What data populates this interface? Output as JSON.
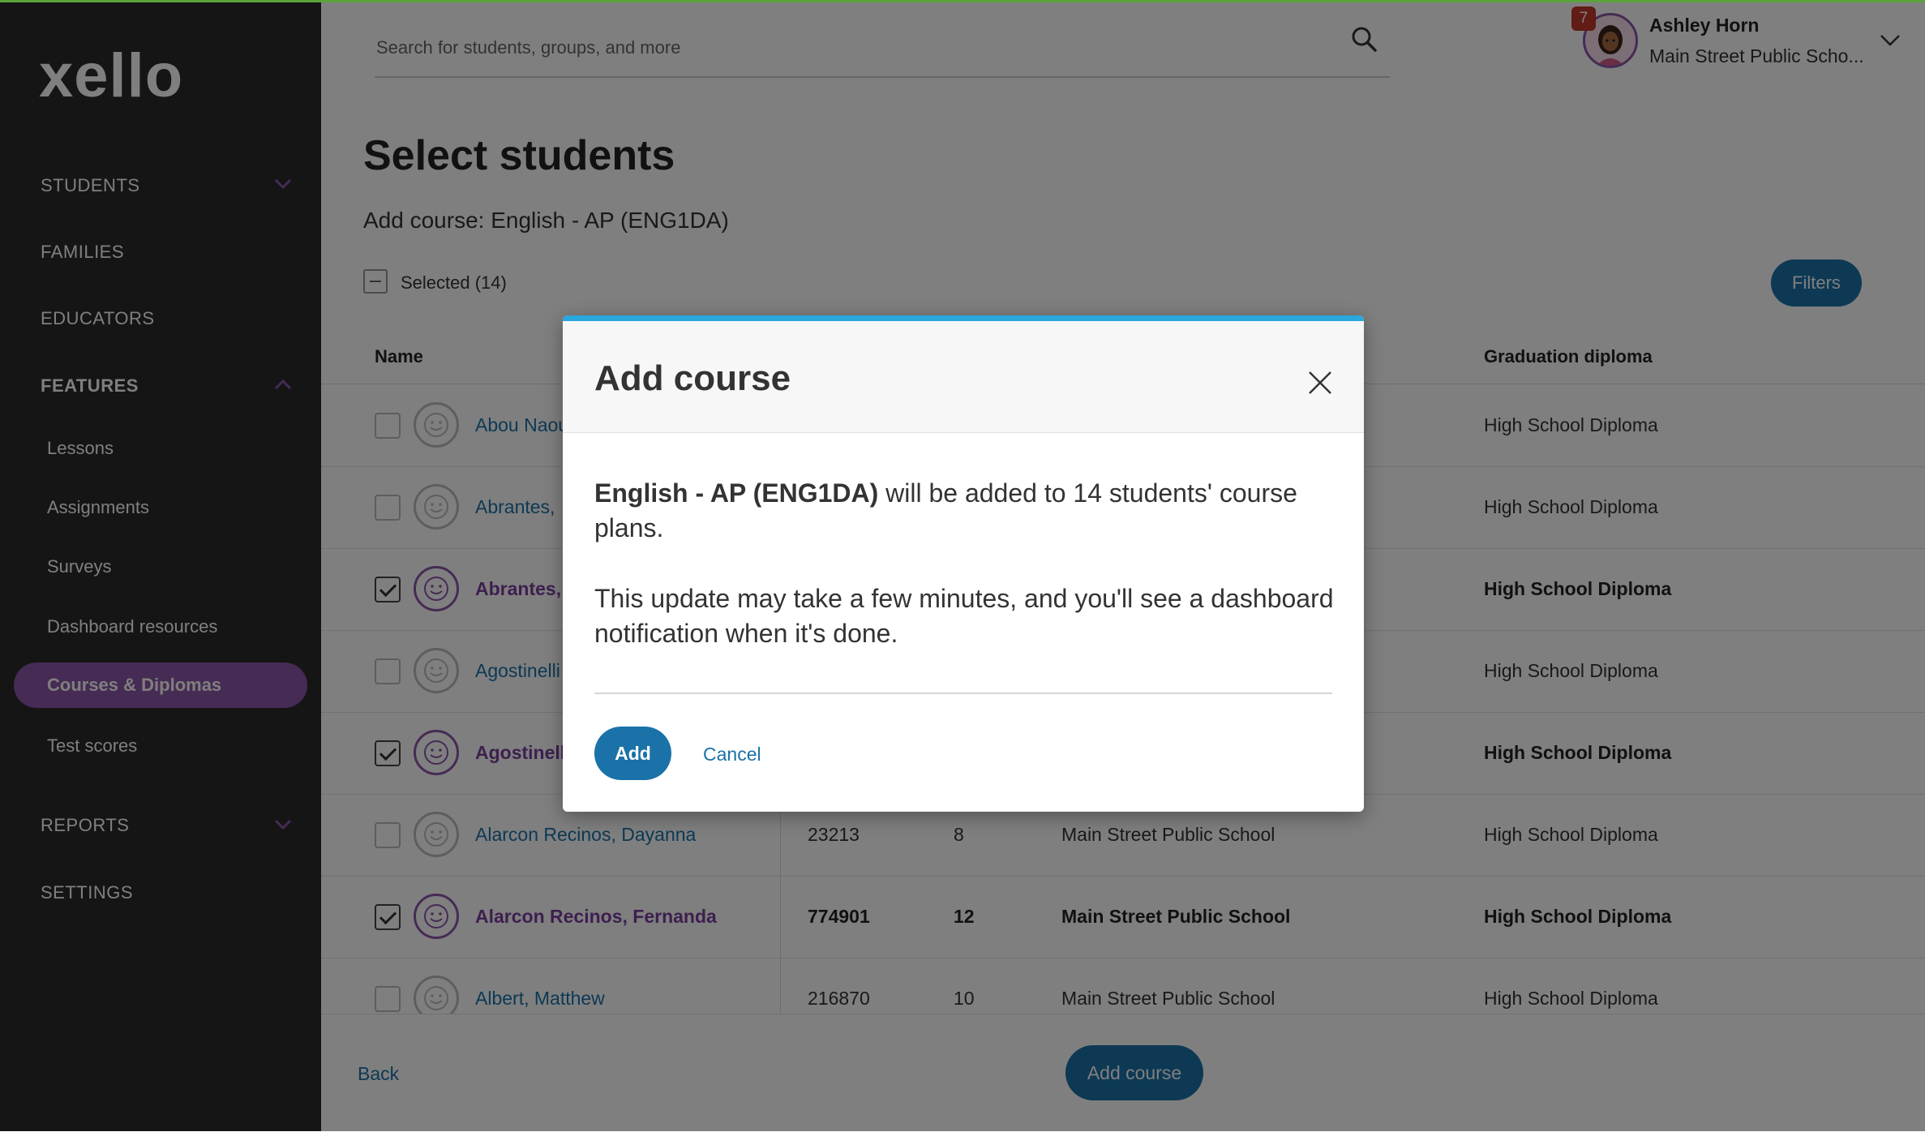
{
  "brand": {
    "logo_text": "xello",
    "accent": "#8c57a8",
    "primary": "#1a72a8",
    "sidebar_bg": "#2b2b2b"
  },
  "sidebar": {
    "students": "STUDENTS",
    "families": "FAMILIES",
    "educators": "EDUCATORS",
    "features": "FEATURES",
    "lessons": "Lessons",
    "assignments": "Assignments",
    "surveys": "Surveys",
    "dashboard_resources": "Dashboard resources",
    "courses_diplomas": "Courses & Diplomas",
    "test_scores": "Test scores",
    "reports": "REPORTS",
    "settings": "SETTINGS"
  },
  "search": {
    "placeholder": "Search for students, groups, and more"
  },
  "user": {
    "name": "Ashley Horn",
    "school": "Main Street Public Scho...",
    "notification_count": "7"
  },
  "page": {
    "title": "Select students",
    "subtitle": "Add course: English - AP (ENG1DA)",
    "selected_label": "Selected (14)",
    "filters_label": "Filters"
  },
  "table": {
    "headers": {
      "name": "Name",
      "diploma": "Graduation diploma"
    },
    "rows": [
      {
        "name": "Abou Naou",
        "id": "",
        "grade": "",
        "school": "",
        "diploma": "High School Diploma",
        "selected": false
      },
      {
        "name": "Abrantes,",
        "id": "",
        "grade": "",
        "school": "",
        "diploma": "High School Diploma",
        "selected": false
      },
      {
        "name": "Abrantes,",
        "id": "",
        "grade": "",
        "school": "",
        "diploma": "High School Diploma",
        "selected": true
      },
      {
        "name": "Agostinelli",
        "id": "",
        "grade": "",
        "school": "",
        "diploma": "High School Diploma",
        "selected": false
      },
      {
        "name": "Agostinell",
        "id": "",
        "grade": "",
        "school": "",
        "diploma": "High School Diploma",
        "selected": true
      },
      {
        "name": "Alarcon Recinos, Dayanna",
        "id": "23213",
        "grade": "8",
        "school": "Main Street Public School",
        "diploma": "High School Diploma",
        "selected": false
      },
      {
        "name": "Alarcon Recinos, Fernanda",
        "id": "774901",
        "grade": "12",
        "school": "Main Street Public School",
        "diploma": "High School Diploma",
        "selected": true
      },
      {
        "name": "Albert, Matthew",
        "id": "216870",
        "grade": "10",
        "school": "Main Street Public School",
        "diploma": "High School Diploma",
        "selected": false
      }
    ]
  },
  "footer": {
    "back_label": "Back",
    "add_course_label": "Add course"
  },
  "modal": {
    "title": "Add course",
    "course_name": "English - AP (ENG1DA)",
    "message_rest": " will be added to 14 students' course plans.",
    "message2": "This update may take a few minutes, and you'll see a dashboard notification when it's done.",
    "add_label": "Add",
    "cancel_label": "Cancel"
  },
  "icons": {
    "search": "search-icon",
    "close": "close-icon",
    "chevron": "chevron-down-icon",
    "avatar": "avatar",
    "student": "smiley-face-icon"
  }
}
